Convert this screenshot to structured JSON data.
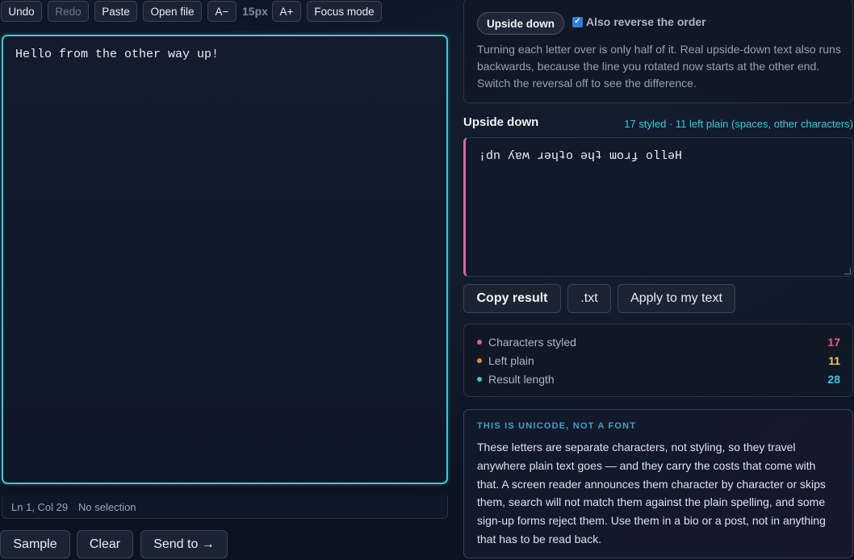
{
  "toolbar": {
    "undo": "Undo",
    "redo": "Redo",
    "paste": "Paste",
    "open_file": "Open file",
    "font_smaller": "A−",
    "font_size": "15px",
    "font_larger": "A+",
    "focus_mode": "Focus mode"
  },
  "editor": {
    "text": "Hello from the other way up!"
  },
  "status": {
    "position": "Ln 1, Col 29",
    "selection": "No selection"
  },
  "bottom_actions": {
    "sample": "Sample",
    "clear": "Clear",
    "send_to": "Send to →"
  },
  "mode": {
    "button": "Upside down",
    "reverse_label": "Also reverse the order",
    "reverse_checked": true,
    "description": "Turning each letter over is only half of it. Real upside-down text also runs backwards, because the line you rotated now starts at the other end. Switch the reversal off to see the difference."
  },
  "output": {
    "title": "Upside down",
    "summary": "17 styled · 11 left plain (spaces, other characters)",
    "text": "¡dn ʎɐʍ ɹǝɥʇo ǝɥʇ ɯoɹɟ ollǝH"
  },
  "output_actions": {
    "copy": "Copy result",
    "txt": ".txt",
    "apply": "Apply to my text"
  },
  "stats": [
    {
      "label": "Characters styled",
      "value": "17",
      "color": "#ef5d7a"
    },
    {
      "label": "Left plain",
      "value": "11",
      "color": "#e88a2e",
      "value_color": "#f2c94c"
    },
    {
      "label": "Result length",
      "value": "28",
      "color": "#3ec8dc"
    }
  ],
  "note": {
    "heading": "THIS IS UNICODE, NOT A FONT",
    "body": "These letters are separate characters, not styling, so they travel anywhere plain text goes — and they carry the costs that come with that. A screen reader announces them character by character or skips them, search will not match them against the plain spelling, and some sign-up forms reject them. Use them in a bio or a post, not in anything that has to be read back."
  }
}
